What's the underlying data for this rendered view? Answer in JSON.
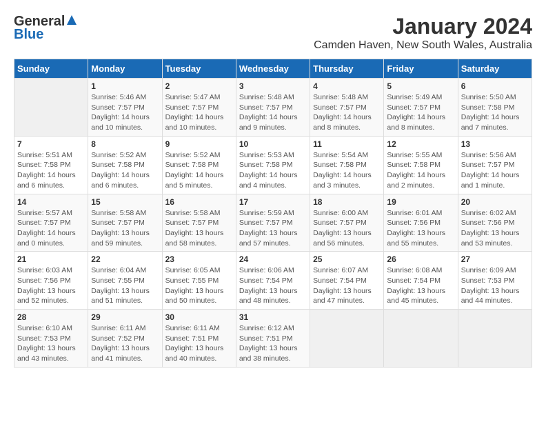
{
  "logo": {
    "general": "General",
    "blue": "Blue"
  },
  "title": "January 2024",
  "subtitle": "Camden Haven, New South Wales, Australia",
  "days_header": [
    "Sunday",
    "Monday",
    "Tuesday",
    "Wednesday",
    "Thursday",
    "Friday",
    "Saturday"
  ],
  "weeks": [
    [
      {
        "day": "",
        "sunrise": "",
        "sunset": "",
        "daylight": "",
        "empty": true
      },
      {
        "day": "1",
        "sunrise": "Sunrise: 5:46 AM",
        "sunset": "Sunset: 7:57 PM",
        "daylight": "Daylight: 14 hours and 10 minutes."
      },
      {
        "day": "2",
        "sunrise": "Sunrise: 5:47 AM",
        "sunset": "Sunset: 7:57 PM",
        "daylight": "Daylight: 14 hours and 10 minutes."
      },
      {
        "day": "3",
        "sunrise": "Sunrise: 5:48 AM",
        "sunset": "Sunset: 7:57 PM",
        "daylight": "Daylight: 14 hours and 9 minutes."
      },
      {
        "day": "4",
        "sunrise": "Sunrise: 5:48 AM",
        "sunset": "Sunset: 7:57 PM",
        "daylight": "Daylight: 14 hours and 8 minutes."
      },
      {
        "day": "5",
        "sunrise": "Sunrise: 5:49 AM",
        "sunset": "Sunset: 7:57 PM",
        "daylight": "Daylight: 14 hours and 8 minutes."
      },
      {
        "day": "6",
        "sunrise": "Sunrise: 5:50 AM",
        "sunset": "Sunset: 7:58 PM",
        "daylight": "Daylight: 14 hours and 7 minutes."
      }
    ],
    [
      {
        "day": "7",
        "sunrise": "Sunrise: 5:51 AM",
        "sunset": "Sunset: 7:58 PM",
        "daylight": "Daylight: 14 hours and 6 minutes."
      },
      {
        "day": "8",
        "sunrise": "Sunrise: 5:52 AM",
        "sunset": "Sunset: 7:58 PM",
        "daylight": "Daylight: 14 hours and 6 minutes."
      },
      {
        "day": "9",
        "sunrise": "Sunrise: 5:52 AM",
        "sunset": "Sunset: 7:58 PM",
        "daylight": "Daylight: 14 hours and 5 minutes."
      },
      {
        "day": "10",
        "sunrise": "Sunrise: 5:53 AM",
        "sunset": "Sunset: 7:58 PM",
        "daylight": "Daylight: 14 hours and 4 minutes."
      },
      {
        "day": "11",
        "sunrise": "Sunrise: 5:54 AM",
        "sunset": "Sunset: 7:58 PM",
        "daylight": "Daylight: 14 hours and 3 minutes."
      },
      {
        "day": "12",
        "sunrise": "Sunrise: 5:55 AM",
        "sunset": "Sunset: 7:58 PM",
        "daylight": "Daylight: 14 hours and 2 minutes."
      },
      {
        "day": "13",
        "sunrise": "Sunrise: 5:56 AM",
        "sunset": "Sunset: 7:57 PM",
        "daylight": "Daylight: 14 hours and 1 minute."
      }
    ],
    [
      {
        "day": "14",
        "sunrise": "Sunrise: 5:57 AM",
        "sunset": "Sunset: 7:57 PM",
        "daylight": "Daylight: 14 hours and 0 minutes."
      },
      {
        "day": "15",
        "sunrise": "Sunrise: 5:58 AM",
        "sunset": "Sunset: 7:57 PM",
        "daylight": "Daylight: 13 hours and 59 minutes."
      },
      {
        "day": "16",
        "sunrise": "Sunrise: 5:58 AM",
        "sunset": "Sunset: 7:57 PM",
        "daylight": "Daylight: 13 hours and 58 minutes."
      },
      {
        "day": "17",
        "sunrise": "Sunrise: 5:59 AM",
        "sunset": "Sunset: 7:57 PM",
        "daylight": "Daylight: 13 hours and 57 minutes."
      },
      {
        "day": "18",
        "sunrise": "Sunrise: 6:00 AM",
        "sunset": "Sunset: 7:57 PM",
        "daylight": "Daylight: 13 hours and 56 minutes."
      },
      {
        "day": "19",
        "sunrise": "Sunrise: 6:01 AM",
        "sunset": "Sunset: 7:56 PM",
        "daylight": "Daylight: 13 hours and 55 minutes."
      },
      {
        "day": "20",
        "sunrise": "Sunrise: 6:02 AM",
        "sunset": "Sunset: 7:56 PM",
        "daylight": "Daylight: 13 hours and 53 minutes."
      }
    ],
    [
      {
        "day": "21",
        "sunrise": "Sunrise: 6:03 AM",
        "sunset": "Sunset: 7:56 PM",
        "daylight": "Daylight: 13 hours and 52 minutes."
      },
      {
        "day": "22",
        "sunrise": "Sunrise: 6:04 AM",
        "sunset": "Sunset: 7:55 PM",
        "daylight": "Daylight: 13 hours and 51 minutes."
      },
      {
        "day": "23",
        "sunrise": "Sunrise: 6:05 AM",
        "sunset": "Sunset: 7:55 PM",
        "daylight": "Daylight: 13 hours and 50 minutes."
      },
      {
        "day": "24",
        "sunrise": "Sunrise: 6:06 AM",
        "sunset": "Sunset: 7:54 PM",
        "daylight": "Daylight: 13 hours and 48 minutes."
      },
      {
        "day": "25",
        "sunrise": "Sunrise: 6:07 AM",
        "sunset": "Sunset: 7:54 PM",
        "daylight": "Daylight: 13 hours and 47 minutes."
      },
      {
        "day": "26",
        "sunrise": "Sunrise: 6:08 AM",
        "sunset": "Sunset: 7:54 PM",
        "daylight": "Daylight: 13 hours and 45 minutes."
      },
      {
        "day": "27",
        "sunrise": "Sunrise: 6:09 AM",
        "sunset": "Sunset: 7:53 PM",
        "daylight": "Daylight: 13 hours and 44 minutes."
      }
    ],
    [
      {
        "day": "28",
        "sunrise": "Sunrise: 6:10 AM",
        "sunset": "Sunset: 7:53 PM",
        "daylight": "Daylight: 13 hours and 43 minutes."
      },
      {
        "day": "29",
        "sunrise": "Sunrise: 6:11 AM",
        "sunset": "Sunset: 7:52 PM",
        "daylight": "Daylight: 13 hours and 41 minutes."
      },
      {
        "day": "30",
        "sunrise": "Sunrise: 6:11 AM",
        "sunset": "Sunset: 7:51 PM",
        "daylight": "Daylight: 13 hours and 40 minutes."
      },
      {
        "day": "31",
        "sunrise": "Sunrise: 6:12 AM",
        "sunset": "Sunset: 7:51 PM",
        "daylight": "Daylight: 13 hours and 38 minutes."
      },
      {
        "day": "",
        "sunrise": "",
        "sunset": "",
        "daylight": "",
        "empty": true
      },
      {
        "day": "",
        "sunrise": "",
        "sunset": "",
        "daylight": "",
        "empty": true
      },
      {
        "day": "",
        "sunrise": "",
        "sunset": "",
        "daylight": "",
        "empty": true
      }
    ]
  ]
}
